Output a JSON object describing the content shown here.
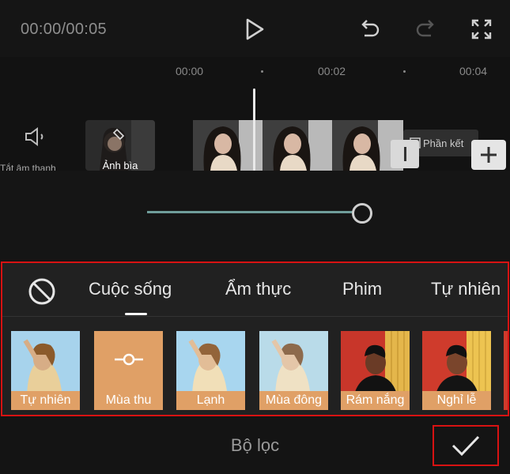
{
  "player": {
    "timecode": "00:00/00:05",
    "icons": [
      "play-icon",
      "undo-icon",
      "redo-icon",
      "fullscreen-icon"
    ]
  },
  "timeline": {
    "ticks": [
      "00:00",
      "00:02",
      "00:04"
    ],
    "mute_label": "Tắt âm thanh",
    "cover_label": "Ảnh bìa",
    "end_label": "Phần kết"
  },
  "slider": {
    "value": 1.0
  },
  "filters": {
    "categories": [
      "Cuộc sống",
      "Ẩm thực",
      "Phim",
      "Tự nhiên"
    ],
    "active_category": "Cuộc sống",
    "items": [
      "Tự nhiên",
      "Mùa thu",
      "Lạnh",
      "Mùa đông",
      "Rám nắng",
      "Nghỉ lễ"
    ],
    "selected": "Mùa thu",
    "accent": "#e0a066",
    "highlight": "#d81212"
  },
  "footer": {
    "title": "Bộ lọc"
  }
}
